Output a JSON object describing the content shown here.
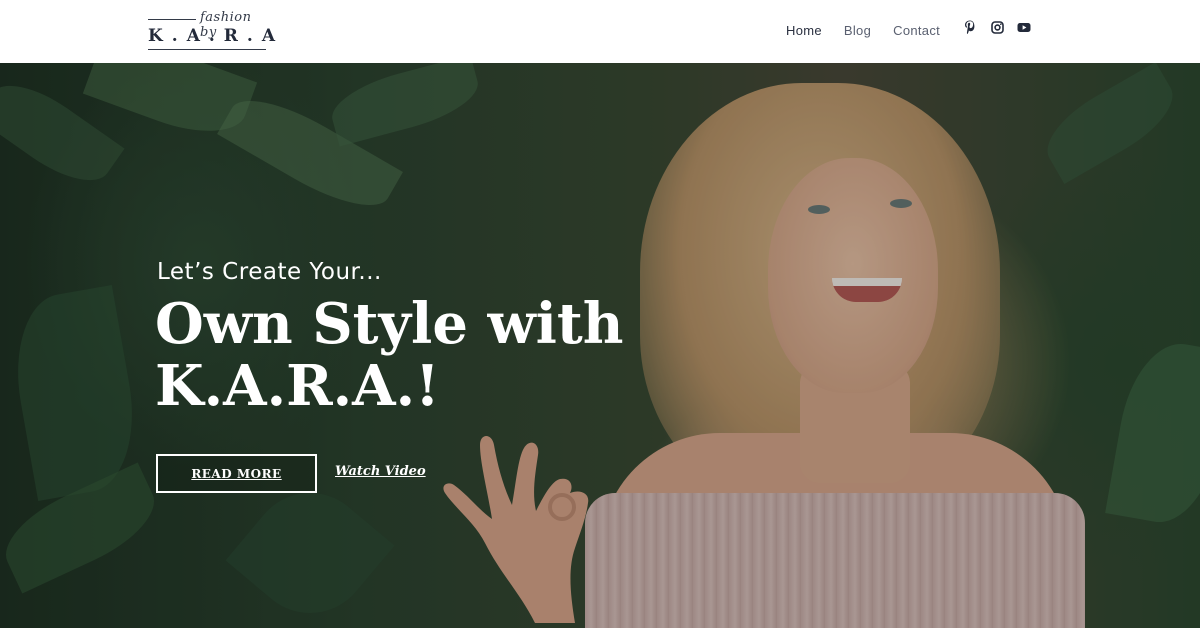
{
  "logo": {
    "script": "fashion by",
    "main": "K.A.R.A"
  },
  "nav": {
    "items": [
      {
        "label": "Home"
      },
      {
        "label": "Blog"
      },
      {
        "label": "Contact"
      }
    ]
  },
  "social": {
    "icons": [
      "pinterest-icon",
      "instagram-icon",
      "youtube-icon"
    ]
  },
  "hero": {
    "subtitle": "Let’s Create Your...",
    "title": "Own Style with K.A.R.A.!",
    "primary_button": "READ MORE",
    "secondary_link": "Watch Video"
  },
  "colors": {
    "header_bg": "#ffffff",
    "nav_text": "#5a6070",
    "logo": "#232a3a",
    "hero_text": "#ffffff"
  }
}
